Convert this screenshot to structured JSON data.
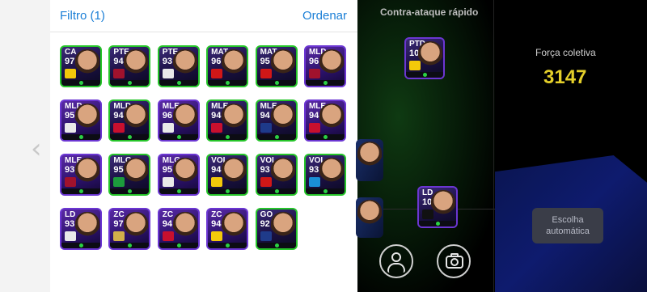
{
  "header": {
    "filter_label": "Filtro (1)",
    "sort_label": "Ordenar"
  },
  "cards": [
    {
      "pos": "CA",
      "ovr": "97",
      "border": "green",
      "flag": "#f3c90a"
    },
    {
      "pos": "PTE",
      "ovr": "94",
      "border": "green",
      "flag": "#a1122d"
    },
    {
      "pos": "PTE",
      "ovr": "93",
      "border": "green",
      "flag": "#e9e9e9"
    },
    {
      "pos": "MAT",
      "ovr": "96",
      "border": "green",
      "flag": "#d01717"
    },
    {
      "pos": "MAT",
      "ovr": "95",
      "border": "green",
      "flag": "#d01717"
    },
    {
      "pos": "MLD",
      "ovr": "96",
      "border": "purple",
      "flag": "#a1122d"
    },
    {
      "pos": "MLD",
      "ovr": "95",
      "border": "purple",
      "flag": "#e9e9e9"
    },
    {
      "pos": "MLD",
      "ovr": "94",
      "border": "green",
      "flag": "#c8102e"
    },
    {
      "pos": "MLE",
      "ovr": "96",
      "border": "purple",
      "flag": "#e9e9e9"
    },
    {
      "pos": "MLE",
      "ovr": "94",
      "border": "green",
      "flag": "#c8102e"
    },
    {
      "pos": "MLE",
      "ovr": "94",
      "border": "green",
      "flag": "#1e3a8a"
    },
    {
      "pos": "MLE",
      "ovr": "94",
      "border": "purple",
      "flag": "#c8102e"
    },
    {
      "pos": "MLE",
      "ovr": "93",
      "border": "purple",
      "flag": "#a1122d"
    },
    {
      "pos": "MLG",
      "ovr": "95",
      "border": "green",
      "flag": "#1c9b3c"
    },
    {
      "pos": "MLG",
      "ovr": "95",
      "border": "purple",
      "flag": "#e9e9e9"
    },
    {
      "pos": "VOL",
      "ovr": "94",
      "border": "green",
      "flag": "#f3c90a"
    },
    {
      "pos": "VOL",
      "ovr": "93",
      "border": "green",
      "flag": "#d01717"
    },
    {
      "pos": "VOL",
      "ovr": "93",
      "border": "green",
      "flag": "#1a8fd6"
    },
    {
      "pos": "LD",
      "ovr": "93",
      "border": "purple",
      "flag": "#e9e9e9"
    },
    {
      "pos": "ZC",
      "ovr": "97",
      "border": "purple",
      "flag": "#d1b04a"
    },
    {
      "pos": "ZC",
      "ovr": "94",
      "border": "purple",
      "flag": "#c8102e"
    },
    {
      "pos": "ZC",
      "ovr": "94",
      "border": "purple",
      "flag": "#f3c90a"
    },
    {
      "pos": "GO",
      "ovr": "92",
      "border": "green",
      "flag": "#1f3b8a"
    }
  ],
  "formation": {
    "mode_label": "Contra-ataque rápido",
    "cards": [
      {
        "pos": "PTD",
        "ovr": "103",
        "flag": "#f3c90a"
      },
      {
        "pos": "LD",
        "ovr": "102",
        "flag": "#111111"
      }
    ]
  },
  "side": {
    "strength_label": "Força coletiva",
    "strength_value": "3147",
    "auto_label": "Escolha automática"
  },
  "icons": {
    "back": "chevron-left-icon",
    "player": "person-icon",
    "camera": "camera-icon"
  }
}
